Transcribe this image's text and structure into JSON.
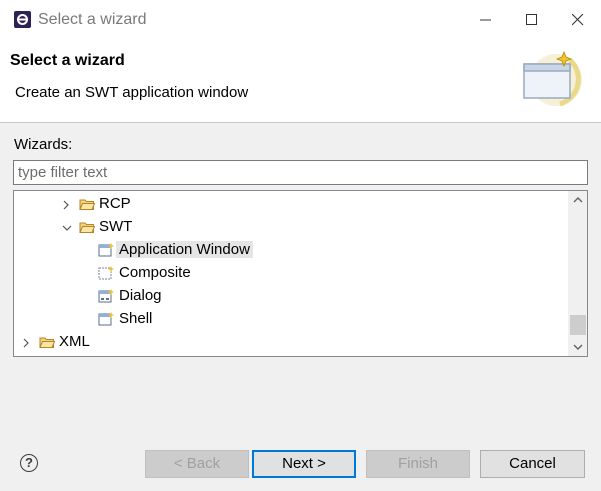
{
  "window": {
    "title": "Select a wizard"
  },
  "header": {
    "title": "Select a wizard",
    "description": "Create an SWT application window"
  },
  "wizards_label": "Wizards:",
  "filter": {
    "placeholder": "type filter text",
    "value": ""
  },
  "tree": {
    "items": [
      {
        "label": "RCP",
        "kind": "folder",
        "expanded": false
      },
      {
        "label": "SWT",
        "kind": "folder",
        "expanded": true
      },
      {
        "label": "Application Window",
        "kind": "wizard",
        "selected": true
      },
      {
        "label": "Composite",
        "kind": "wizard"
      },
      {
        "label": "Dialog",
        "kind": "wizard"
      },
      {
        "label": "Shell",
        "kind": "wizard"
      },
      {
        "label": "XML",
        "kind": "folder",
        "expanded": false
      }
    ]
  },
  "buttons": {
    "back": "< Back",
    "next": "Next >",
    "finish": "Finish",
    "cancel": "Cancel"
  },
  "colors": {
    "accent": "#0078d7",
    "folder": "#e8b84a",
    "selection": "#e5e5e5"
  }
}
